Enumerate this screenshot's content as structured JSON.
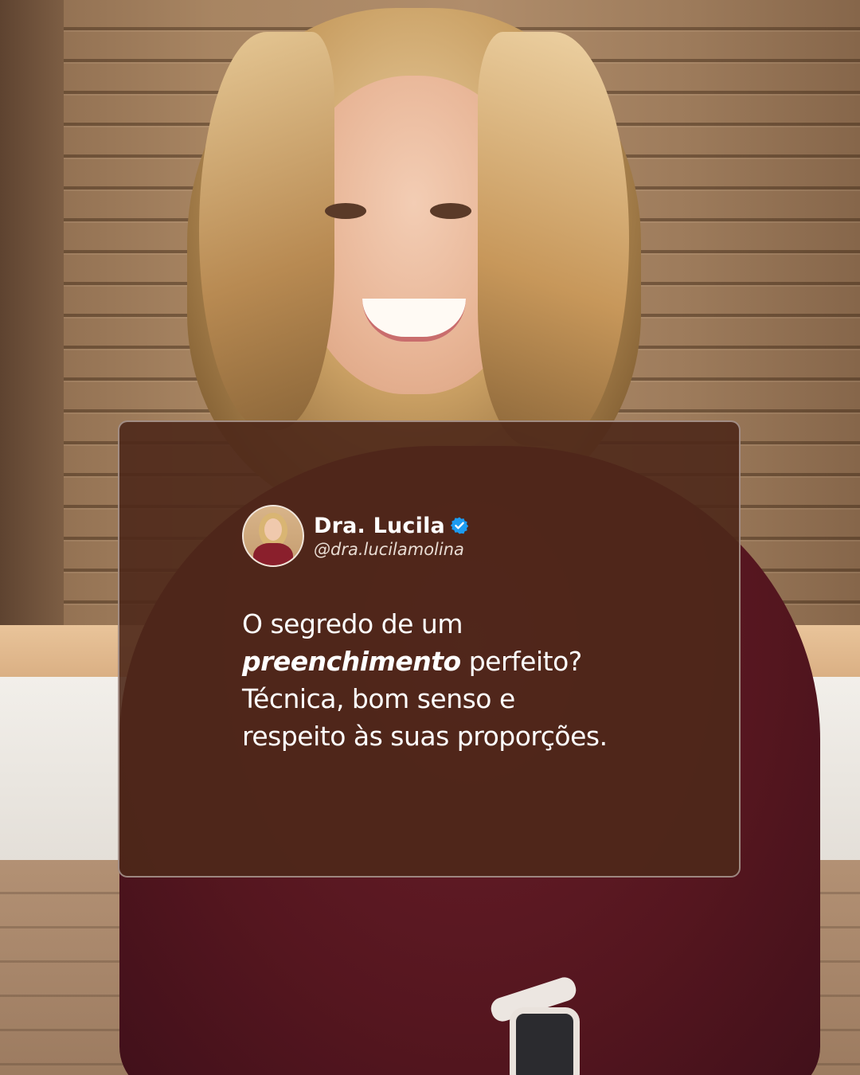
{
  "tweet": {
    "display_name": "Dra. Lucila",
    "handle": "@dra.lucilamolina",
    "verified_icon": "verified-badge-icon",
    "verified_color": "#1d9bf0",
    "card_color": "#4e281a",
    "text": {
      "line1": "O segredo de um",
      "line2_emphasis": "preenchimento",
      "line2_rest": " perfeito?",
      "line3": "Técnica, bom senso e",
      "line4": "respeito às suas proporções."
    }
  }
}
